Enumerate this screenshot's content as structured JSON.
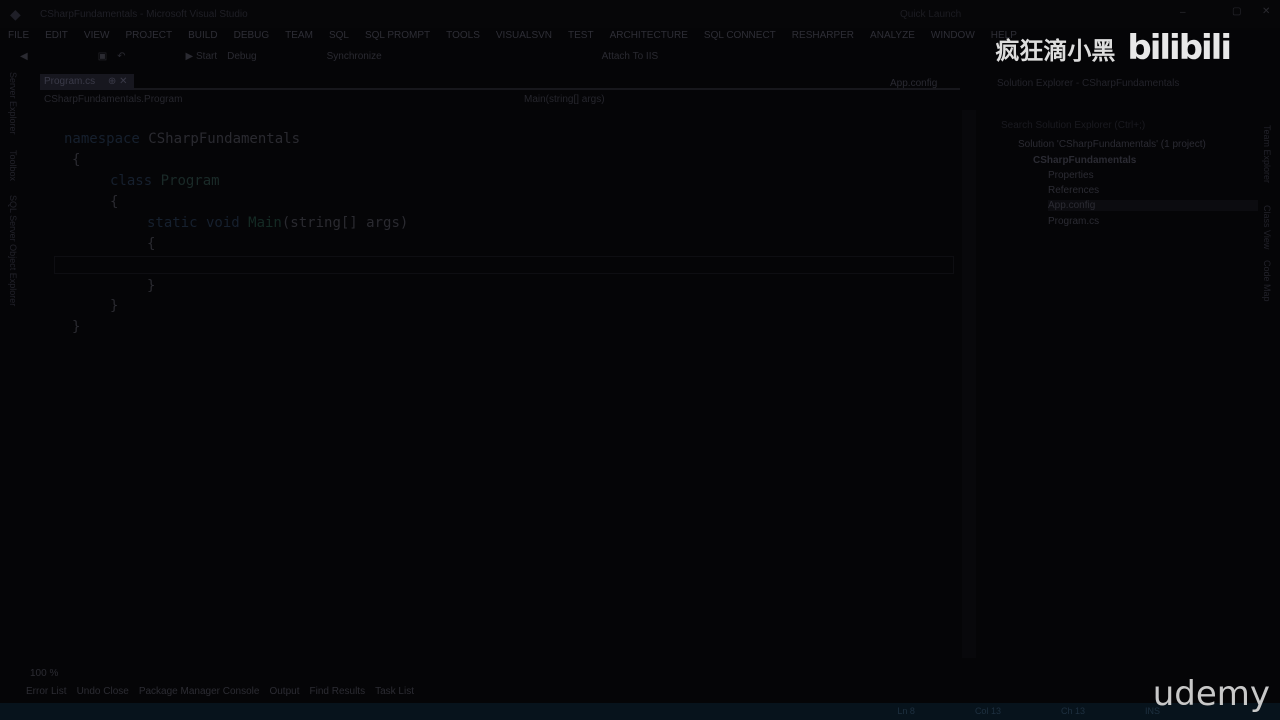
{
  "title": "CSharpFundamentals - Microsoft Visual Studio",
  "quick_launch": "Quick Launch",
  "menu": [
    "FILE",
    "EDIT",
    "VIEW",
    "PROJECT",
    "BUILD",
    "DEBUG",
    "TEAM",
    "SQL",
    "SQL PROMPT",
    "TOOLS",
    "VISUALSVN",
    "TEST",
    "ARCHITECTURE",
    "SQL CONNECT",
    "RESHARPER",
    "ANALYZE",
    "WINDOW",
    "HELP"
  ],
  "toolbar": {
    "start": "Start",
    "config": "Debug",
    "sync": "Synchronize",
    "attach": "Attach To IIS"
  },
  "tabs": {
    "active": "Program.cs",
    "other": "App.config"
  },
  "nav": {
    "left": "CSharpFundamentals.Program",
    "right": "Main(string[] args)"
  },
  "code": {
    "l1a": "namespace",
    "l1b": " CSharpFundamentals",
    "l2": "{",
    "l3a": "class",
    "l3b": " Program",
    "l4": "{",
    "l5a": "static void",
    "l5b": " Main",
    "l5c": "(string[] args)",
    "l6": "{",
    "l7": "}",
    "l8": "}",
    "l9": "}"
  },
  "solution": {
    "header": "Solution Explorer - CSharpFundamentals",
    "search": "Search Solution Explorer (Ctrl+;)",
    "items": [
      "Solution 'CSharpFundamentals' (1 project)",
      "CSharpFundamentals",
      "Properties",
      "References",
      "App.config",
      "Program.cs"
    ]
  },
  "left_side": [
    "Server Explorer",
    "Toolbox",
    "SQL Server Object Explorer"
  ],
  "right_side": [
    "Team Explorer",
    "Class View",
    "Code Map"
  ],
  "bottom": {
    "zoom": "100 %",
    "tabs": [
      "Error List",
      "Undo Close",
      "Package Manager Console",
      "Output",
      "Find Results",
      "Task List"
    ]
  },
  "status": {
    "ln": "Ln 8",
    "col": "Col 13",
    "ch": "Ch 13",
    "mode": "INS"
  },
  "watermark": {
    "author": "疯狂滴小黑",
    "logo": "bilibili",
    "udemy": "udemy"
  }
}
